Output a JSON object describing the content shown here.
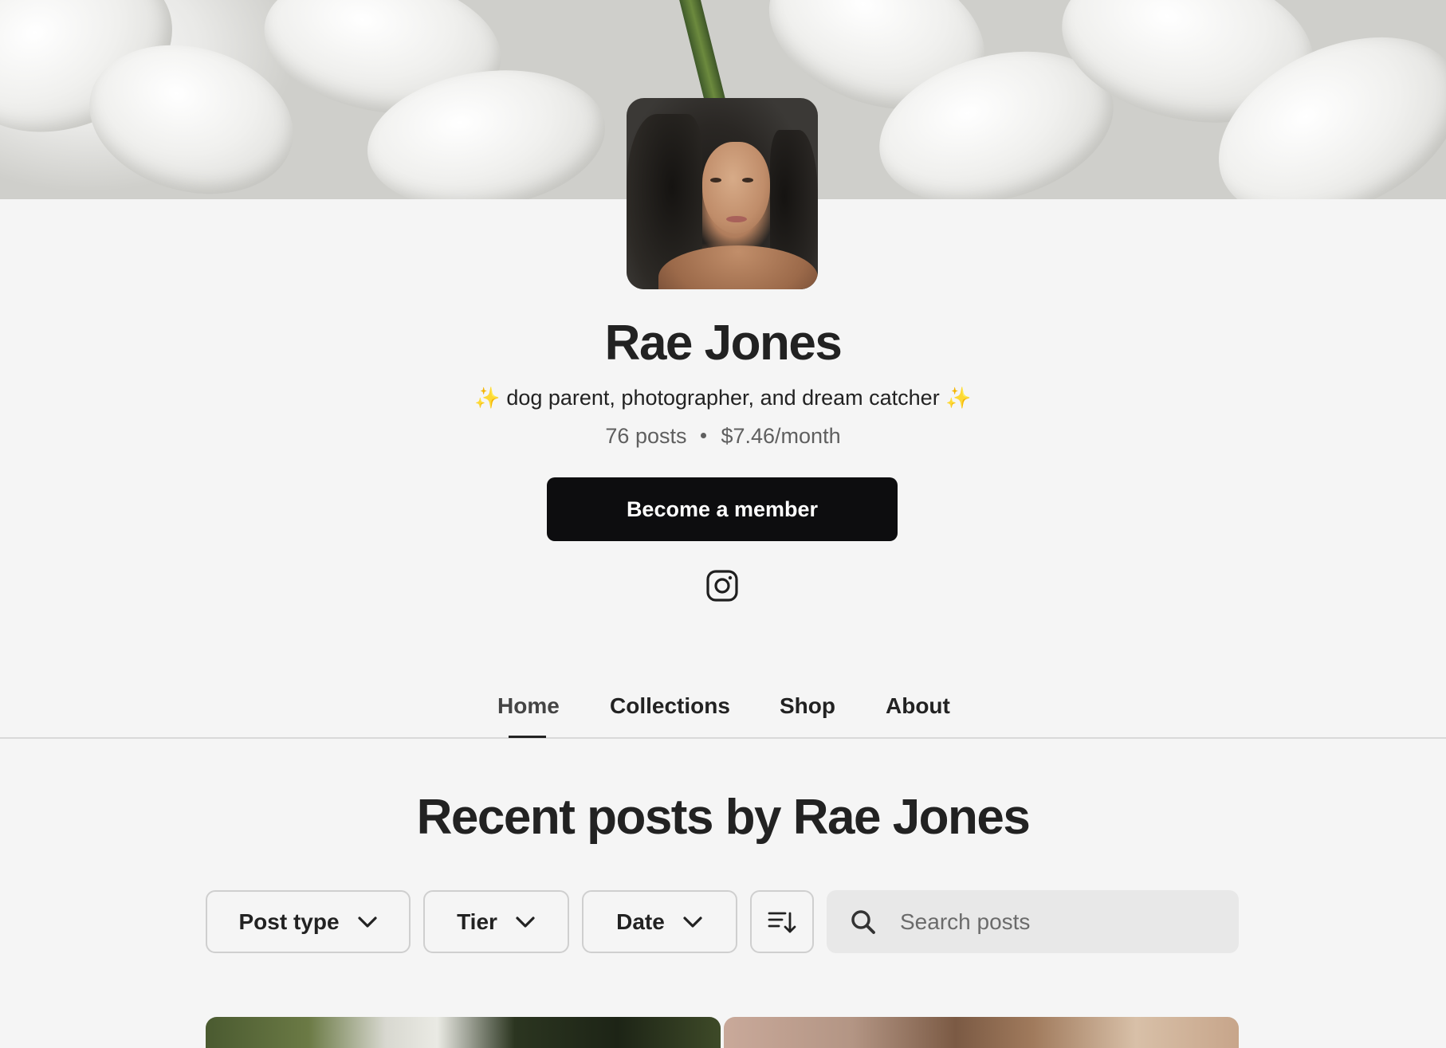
{
  "creator": {
    "name": "Rae Jones",
    "tagline_sparkle_left": "✨",
    "tagline": "dog parent, photographer, and dream catcher",
    "tagline_sparkle_right": "✨",
    "posts_count": "76 posts",
    "price": "$7.46/month"
  },
  "cta": {
    "label": "Become a member"
  },
  "social": {
    "icon": "instagram-icon"
  },
  "tabs": [
    {
      "label": "Home",
      "active": true
    },
    {
      "label": "Collections",
      "active": false
    },
    {
      "label": "Shop",
      "active": false
    },
    {
      "label": "About",
      "active": false
    }
  ],
  "section": {
    "title": "Recent posts by Rae Jones"
  },
  "filters": {
    "post_type": "Post type",
    "tier": "Tier",
    "date": "Date",
    "sort_icon": "sort-descending-icon"
  },
  "search": {
    "placeholder": "Search posts"
  },
  "colors": {
    "background": "#f5f5f5",
    "cta_bg": "#0d0d0f",
    "cta_text": "#ffffff",
    "search_bg": "#e8e8e8",
    "sparkle": "#f2c94c"
  }
}
